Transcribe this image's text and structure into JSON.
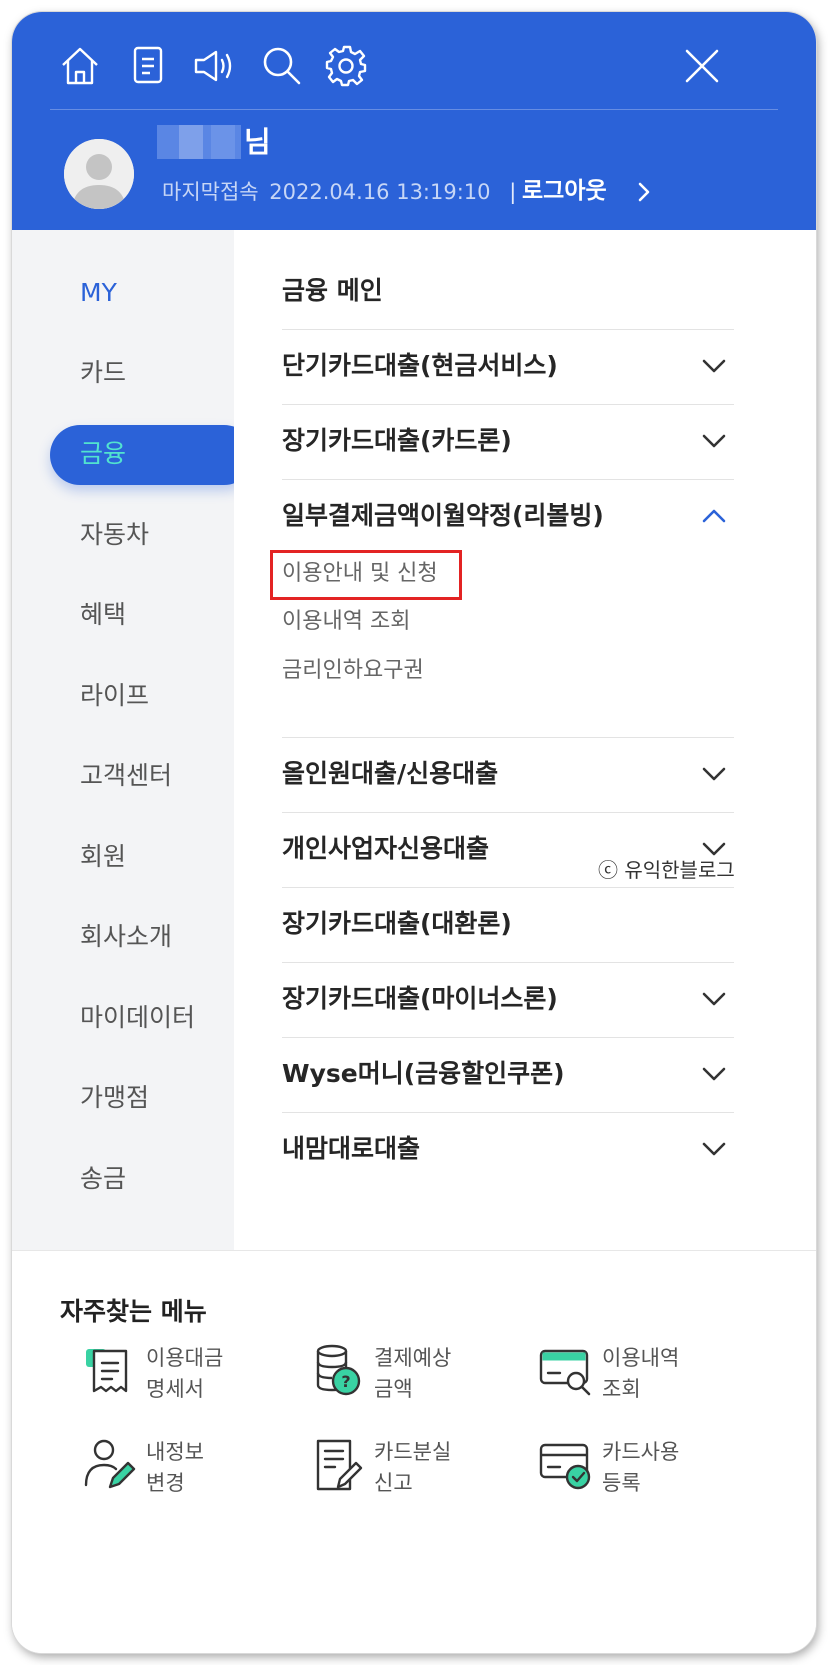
{
  "header": {
    "name_suffix": "님",
    "last_login_label": "마지막접속",
    "last_login_time": "2022.04.16 13:19:10",
    "separator": "|",
    "logout_label": "로그아웃",
    "icons": [
      "home-icon",
      "document-icon",
      "speaker-icon",
      "search-icon",
      "gear-icon",
      "close-icon"
    ],
    "bg_color": "#2b62d8"
  },
  "nav": {
    "items": [
      "MY",
      "카드",
      "금융",
      "자동차",
      "혜택",
      "라이프",
      "고객센터",
      "회원",
      "회사소개",
      "마이데이터",
      "가맹점",
      "송금"
    ],
    "active": "금융",
    "active_color": "#52e3cf"
  },
  "finance": {
    "main_label": "금융 메인",
    "sections": [
      {
        "label": "단기카드대출(현금서비스)",
        "chevron": "down"
      },
      {
        "label": "장기카드대출(카드론)",
        "chevron": "down"
      },
      {
        "label": "일부결제금액이월약정(리볼빙)",
        "chevron": "up",
        "expanded": true,
        "subitems": [
          "이용안내 및 신청",
          "이용내역 조회",
          "금리인하요구권"
        ]
      },
      {
        "label": "올인원대출/신용대출",
        "chevron": "down"
      },
      {
        "label": "개인사업자신용대출",
        "chevron": "down"
      },
      {
        "label": "장기카드대출(대환론)",
        "chevron": "none"
      },
      {
        "label": "장기카드대출(마이너스론)",
        "chevron": "down"
      },
      {
        "label": "Wyse머니(금융할인쿠폰)",
        "chevron": "down"
      },
      {
        "label": "내맘대로대출",
        "chevron": "down"
      }
    ],
    "highlighted_subitem": "이용안내 및 신청",
    "highlight_color": "#e32323"
  },
  "watermark": "ⓒ 유익한블로그",
  "frequent": {
    "title": "자주찾는 메뉴",
    "items": [
      {
        "line1": "이용대금",
        "line2": "명세서",
        "icon": "receipt-icon"
      },
      {
        "line1": "결제예상",
        "line2": "금액",
        "icon": "coins-question-icon"
      },
      {
        "line1": "이용내역",
        "line2": "조회",
        "icon": "card-search-icon"
      },
      {
        "line1": "내정보",
        "line2": "변경",
        "icon": "user-edit-icon"
      },
      {
        "line1": "카드분실",
        "line2": "신고",
        "icon": "document-edit-icon"
      },
      {
        "line1": "카드사용",
        "line2": "등록",
        "icon": "card-check-icon"
      }
    ],
    "accent_color": "#39d2a3"
  }
}
